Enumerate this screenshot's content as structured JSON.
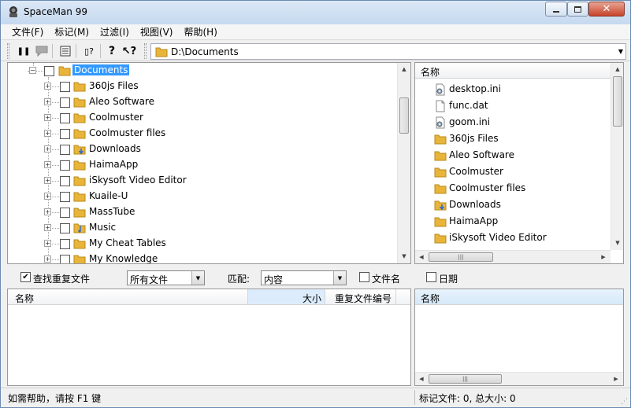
{
  "window": {
    "title": "SpaceMan 99",
    "controls": [
      "minimize",
      "maximize",
      "close"
    ]
  },
  "menu": [
    "文件(F)",
    "标记(M)",
    "过滤(I)",
    "视图(V)",
    "帮助(H)"
  ],
  "toolbar": {
    "path": "D:\\Documents"
  },
  "tree": {
    "root": "Documents",
    "items": [
      "360js Files",
      "Aleo Software",
      "Coolmuster",
      "Coolmuster files",
      "Downloads",
      "HaimaApp",
      "iSkysoft Video Editor",
      "Kuaile-U",
      "MassTube",
      "Music",
      "My Cheat Tables",
      "My Knowledge"
    ]
  },
  "filelist": {
    "header": "名称",
    "items": [
      {
        "name": "desktop.ini",
        "icon": "settings-file-icon"
      },
      {
        "name": "func.dat",
        "icon": "file-icon"
      },
      {
        "name": "goom.ini",
        "icon": "settings-file-icon"
      },
      {
        "name": "360js Files",
        "icon": "folder-icon"
      },
      {
        "name": "Aleo Software",
        "icon": "folder-icon"
      },
      {
        "name": "Coolmuster",
        "icon": "folder-icon"
      },
      {
        "name": "Coolmuster files",
        "icon": "folder-icon"
      },
      {
        "name": "Downloads",
        "icon": "downloads-folder-icon"
      },
      {
        "name": "HaimaApp",
        "icon": "folder-icon"
      },
      {
        "name": "iSkysoft Video Editor",
        "icon": "folder-icon"
      }
    ]
  },
  "filter": {
    "find_duplicates": "查找重复文件",
    "find_duplicates_checked": true,
    "file_type": "所有文件",
    "match_label": "匹配:",
    "match_value": "内容",
    "filename_label": "文件名",
    "date_label": "日期"
  },
  "results": {
    "col_name": "名称",
    "col_size": "大小",
    "col_dup": "重复文件编号"
  },
  "bottom_right": {
    "col_name": "名称"
  },
  "status": {
    "help": "如需帮助，请按 F1 键",
    "summary": "标记文件: 0,  总大小: 0"
  },
  "colors": {
    "selection": "#3399ff",
    "folder": "#e8b53a",
    "title_bar": "#c6d9ef",
    "close_button": "#c8442b"
  }
}
